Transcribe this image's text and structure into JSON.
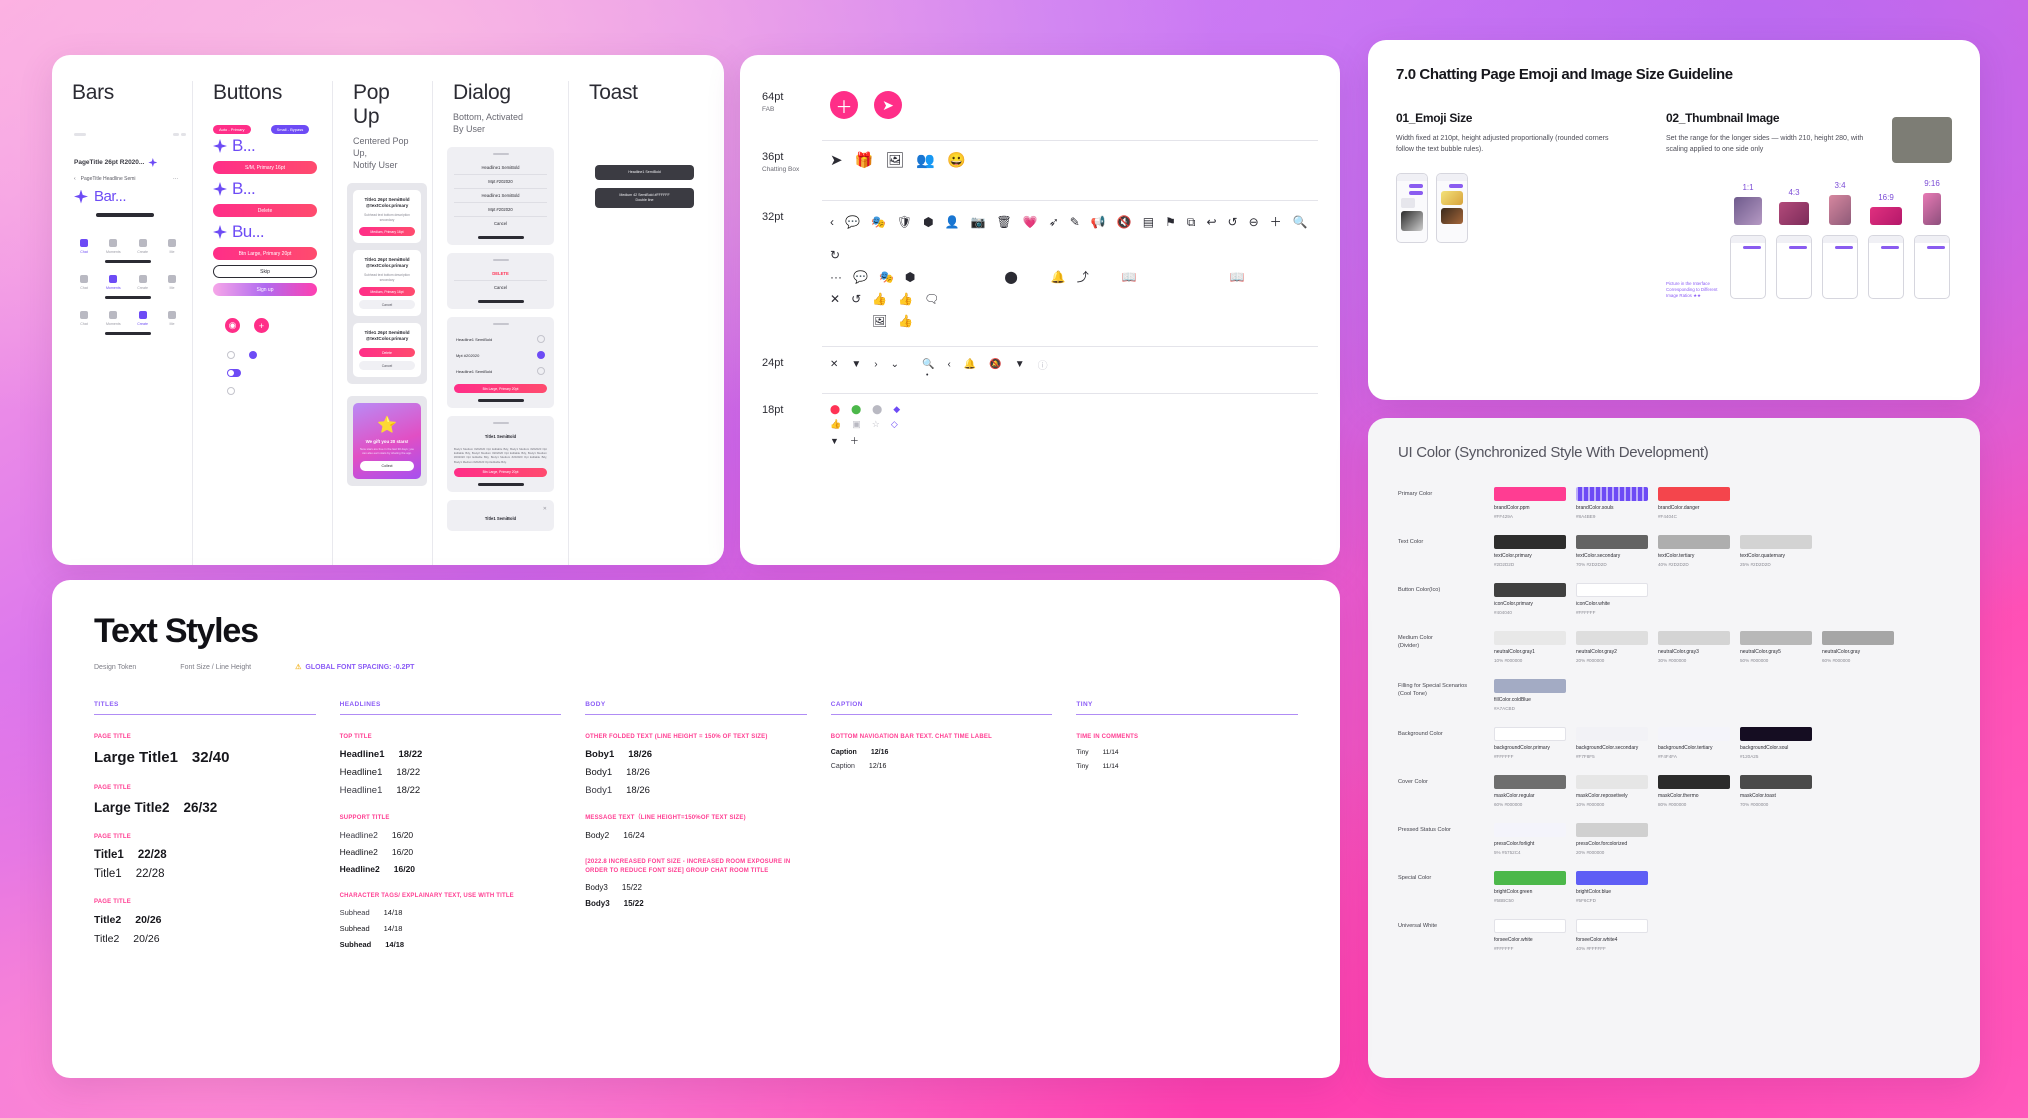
{
  "components": {
    "columns": [
      {
        "title": "Bars",
        "subtitle": ""
      },
      {
        "title": "Buttons",
        "subtitle": ""
      },
      {
        "title": "Pop Up",
        "subtitle": "Centered Pop Up,\nNotify User"
      },
      {
        "title": "Dialog",
        "subtitle": "Bottom, Activated\nBy User"
      },
      {
        "title": "Toast",
        "subtitle": ""
      }
    ],
    "bars": {
      "page_title": "PageTitle 26pt R2020...",
      "nav_label": "PageTitle Headline Semi",
      "big_bar_label": "Bar...",
      "tab_items": [
        "Chat",
        "Moments",
        "Create",
        "Me"
      ]
    },
    "buttons": {
      "tag_primary": "Auto - Primary",
      "tag_layers": "Small - Bypass",
      "label_b1": "B...",
      "label_b2": "B...",
      "label_b3": "Bu...",
      "pill_small": "S/M, Primary 16pt",
      "pill_delete": "Delete",
      "pill_large": "Btn Large, Primary 20pt",
      "pill_skip": "Skip",
      "pill_signup": "Sign up"
    },
    "popup": {
      "cards": [
        {
          "title": "Title1 26pt SemiBold\n@textColor.primary",
          "body": "Subhead text bottom description secondary",
          "primary": "Medium, Primary 16pt",
          "secondary": ""
        },
        {
          "title": "Title1 26pt SemiBold\n@textColor.primary",
          "body": "Subhead text bottom description secondary",
          "primary": "Medium, Primary 16pt",
          "secondary": "Cancel"
        },
        {
          "title": "Title1 26pt SemiBold\n@textColor.primary",
          "body": "",
          "primary": "Delete",
          "secondary": "Cancel"
        }
      ],
      "gift": {
        "title": "We gift you 20 stars!",
        "body": "New stars are free in the last 30 days; you can also earn stars by sharing the app.",
        "button": "Collect"
      }
    },
    "dialog": {
      "sheet1": [
        "Headline1 SemiBold",
        "Mpt #202020",
        "Headline1 SemiBold",
        "Mpt #202020",
        "Cancel"
      ],
      "sheet2": [
        "DELETE",
        "Cancel"
      ],
      "sheet3_options": [
        "Headline1 SemiBold",
        "Mpt #202020",
        "Headline1 SemiBold"
      ],
      "sheet3_button": "Btn Large, Primary 20pt",
      "sheet4_title": "Title1 SemiBold",
      "sheet4_body": "Body1 Medium #202020 Opt Editable Bdy, Body1 Medium #202020 Opt Editable Bdy, Body2 Medium #202020 Opt Editable Bdy, Body1 Medium #202020 Opt Editable Bdy, Body1 Medium #202020 Opt Editable Bdy, Body1 Medium #202020 Opt Editable Bdy.",
      "sheet4_button": "Btn Large, Primary 20pt",
      "sheet5_title": "Title1 SemiBold"
    },
    "toast": {
      "items": [
        "Headline1 SemiBold",
        "Medium 42 SemiBold #FFFFFF\nDouble line"
      ]
    }
  },
  "icons": {
    "sizes": [
      {
        "pt": "64pt",
        "note": "FAB"
      },
      {
        "pt": "36pt",
        "note": "Chatting Box"
      },
      {
        "pt": "32pt",
        "note": ""
      },
      {
        "pt": "24pt",
        "note": ""
      },
      {
        "pt": "18pt",
        "note": ""
      }
    ]
  },
  "emoji_guideline": {
    "title": "7.0 Chatting Page Emoji and Image Size Guideline",
    "section1": {
      "heading": "01_Emoji Size",
      "body": "Width fixed at 210pt, height adjusted proportionally (rounded corners follow the text bubble rules)."
    },
    "section2": {
      "heading": "02_Thumbnail Image",
      "body": "Set the range for the longer sides — width 210, height 280, with scaling applied to one side only",
      "ratios": [
        "1:1",
        "4:3",
        "3:4",
        "16:9",
        "9:16"
      ],
      "side_note": "Picture in the Interface Corresponding to Different Image Ratios ★★"
    }
  },
  "ui_color": {
    "title": "UI Color (Synchronized Style With Development)",
    "rows": [
      {
        "label": "Primary Color",
        "swatches": [
          {
            "name": "brandColor.ppm",
            "hex": "#FF429A",
            "color": "#ff3d92",
            "dotted": false
          },
          {
            "name": "brandColor.souls",
            "hex": "#8A4BE9",
            "color": "#6d4bf5",
            "dotted": true
          },
          {
            "name": "brandColor.danger",
            "hex": "#F4404C",
            "color": "#f4454c",
            "dotted": false
          }
        ]
      },
      {
        "label": "Text Color",
        "swatches": [
          {
            "name": "textColor.primary",
            "hex": "#2D2D2D",
            "color": "#2d2d2d",
            "dotted": false
          },
          {
            "name": "textColor.secondary",
            "hex": "70% #2D2D2D",
            "color": "#636363",
            "dotted": false
          },
          {
            "name": "textColor.tertiary",
            "hex": "40% #2D2D2D",
            "color": "#aeaeae",
            "dotted": false
          },
          {
            "name": "textColor.quaternary",
            "hex": "25% #2D2D2D",
            "color": "#d3d3d3",
            "dotted": false
          }
        ]
      },
      {
        "label": "Button Color(Ico)",
        "swatches": [
          {
            "name": "iconColor.primary",
            "hex": "#404040",
            "color": "#404040",
            "dotted": false
          },
          {
            "name": "iconColor.white",
            "hex": "#FFFFFF",
            "color": "#ffffff",
            "dotted": false
          }
        ]
      },
      {
        "label": "Medium Color\n(Divider)",
        "swatches": [
          {
            "name": "neutralColor.gray1",
            "hex": "10% #000000",
            "color": "#e8e8e8",
            "dotted": false
          },
          {
            "name": "neutralColor.gray2",
            "hex": "20% #000000",
            "color": "#dedede",
            "dotted": false
          },
          {
            "name": "neutralColor.gray3",
            "hex": "30% #000000",
            "color": "#d4d4d4",
            "dotted": false
          },
          {
            "name": "neutralColor.gray5",
            "hex": "50% #000000",
            "color": "#b8b8b8",
            "dotted": false
          },
          {
            "name": "neutralColor.gray",
            "hex": "60% #000000",
            "color": "#a6a6a6",
            "dotted": false
          }
        ]
      },
      {
        "label": "Filling for Special Scenarios\n(Cool Tone)",
        "swatches": [
          {
            "name": "fillColor.coldBlue",
            "hex": "#A7ACBD",
            "color": "#a3abc4",
            "dotted": false
          }
        ]
      },
      {
        "label": "Background Color",
        "swatches": [
          {
            "name": "backgroundColor.primary",
            "hex": "#FFFFFF",
            "color": "#ffffff",
            "dotted": false
          },
          {
            "name": "backgroundColor.secondary",
            "hex": "#F7F8F5",
            "color": "#f2f2f6",
            "dotted": false
          },
          {
            "name": "backgroundColor.tertiary",
            "hex": "#F4F4FA",
            "color": "#f4f4fa",
            "dotted": false
          },
          {
            "name": "backgroundColor.soul",
            "hex": "#120A25",
            "color": "#150d22",
            "dotted": false
          }
        ]
      },
      {
        "label": "Cover Color",
        "swatches": [
          {
            "name": "maskColor.regular",
            "hex": "60% #000000",
            "color": "#6e6e6e",
            "dotted": false
          },
          {
            "name": "maskColor.reposetively",
            "hex": "10% #000000",
            "color": "#e6e6e6",
            "dotted": false
          },
          {
            "name": "maskColor.thermo",
            "hex": "80% #000000",
            "color": "#2b2b2b",
            "dotted": false
          },
          {
            "name": "maskColor.toast",
            "hex": "70% #000000",
            "color": "#4a4a4a",
            "dotted": false
          }
        ]
      },
      {
        "label": "Pressed Status Color",
        "swatches": [
          {
            "name": "pressColor.forlight",
            "hex": "5% #5752C4",
            "color": "#f4f4fb",
            "dotted": false
          },
          {
            "name": "pressColor.forcolorized",
            "hex": "20% #000000",
            "color": "#d0d0d0",
            "dotted": false
          }
        ]
      },
      {
        "label": "Special Color",
        "swatches": [
          {
            "name": "brightColor.green",
            "hex": "#5BBC50",
            "color": "#4cb84a",
            "dotted": false
          },
          {
            "name": "brightColor.blue",
            "hex": "#5F6CFD",
            "color": "#5f5ef5",
            "dotted": false
          }
        ]
      },
      {
        "label": "Universal White",
        "swatches": [
          {
            "name": "forseeColor.white",
            "hex": "#FFFFFF",
            "color": "#ffffff",
            "dotted": false
          },
          {
            "name": "forseeColor.white4",
            "hex": "40% #FFFFFF",
            "color": "#ffffff",
            "dotted": false
          }
        ]
      }
    ]
  },
  "text_styles": {
    "title": "Text Styles",
    "meta_token": "Design Token",
    "meta_size": "Font Size / Line Height",
    "meta_warning": "GLOBAL FONT SPACING: -0.2PT",
    "columns": [
      {
        "head": "TITLES",
        "groups": [
          {
            "tag": "PAGE TITLE",
            "rows": [
              {
                "name": "Large Title1",
                "size": "32/40",
                "weight": "700",
                "cls": "s32"
              }
            ]
          },
          {
            "tag": "PAGE TITLE",
            "rows": [
              {
                "name": "Large Title2",
                "size": "26/32",
                "weight": "700",
                "cls": "s26"
              }
            ]
          },
          {
            "tag": "PAGE TITLE",
            "rows": [
              {
                "name": "Title1",
                "size": "22/28",
                "weight": "700",
                "cls": "s22"
              },
              {
                "name": "Title1",
                "size": "22/28",
                "weight": "400",
                "cls": "s22"
              }
            ]
          },
          {
            "tag": "PAGE TITLE",
            "rows": [
              {
                "name": "Title2",
                "size": "20/26",
                "weight": "700",
                "cls": "s20"
              },
              {
                "name": "Title2",
                "size": "20/26",
                "weight": "400",
                "cls": "s20"
              }
            ]
          }
        ]
      },
      {
        "head": "HEADLINES",
        "groups": [
          {
            "tag": "TOP TITLE",
            "rows": [
              {
                "name": "Headline1",
                "size": "18/22",
                "weight": "700",
                "cls": "s18"
              },
              {
                "name": "Headline1",
                "size": "18/22",
                "weight": "400",
                "cls": "s18"
              },
              {
                "name": "Headline1",
                "size": "18/22",
                "weight": "300",
                "cls": "s18"
              }
            ]
          },
          {
            "tag": "SUPPORT TITLE",
            "rows": [
              {
                "name": "Headline2",
                "size": "16/20",
                "weight": "300",
                "cls": "s16"
              },
              {
                "name": "Headline2",
                "size": "16/20",
                "weight": "400",
                "cls": "s16"
              },
              {
                "name": "Headline2",
                "size": "16/20",
                "weight": "700",
                "cls": "s16"
              }
            ]
          },
          {
            "tag": "CHARACTER TAGS/ EXPLAINARY TEXT, USE WITH TITLE",
            "rows": [
              {
                "name": "Subhead",
                "size": "14/18",
                "weight": "300",
                "cls": "s14"
              },
              {
                "name": "Subhead",
                "size": "14/18",
                "weight": "400",
                "cls": "s14"
              },
              {
                "name": "Subhead",
                "size": "14/18",
                "weight": "700",
                "cls": "s14"
              }
            ]
          }
        ]
      },
      {
        "head": "BODY",
        "groups": [
          {
            "tag": "OTHER FOLDED TEXT (LINE HEIGHT = 150% OF TEXT SIZE)",
            "rows": [
              {
                "name": "Boby1",
                "size": "18/26",
                "weight": "700",
                "cls": "s18"
              },
              {
                "name": "Body1",
                "size": "18/26",
                "weight": "400",
                "cls": "s18"
              },
              {
                "name": "Body1",
                "size": "18/26",
                "weight": "300",
                "cls": "s18"
              }
            ]
          },
          {
            "tag": "MESSAGE TEXT（LINE HEIGHT=150%OF TEXT SIZE)",
            "rows": [
              {
                "name": "Body2",
                "size": "16/24",
                "weight": "400",
                "cls": "s16"
              }
            ]
          },
          {
            "tag": "[2022.8 INCREASED FONT SIZE - INCREASED ROOM EXPOSURE IN ORDER TO REDUCE FONT SIZE] GROUP CHAT ROOM TITLE",
            "rows": [
              {
                "name": "Body3",
                "size": "15/22",
                "weight": "400",
                "cls": "s15"
              },
              {
                "name": "Body3",
                "size": "15/22",
                "weight": "700",
                "cls": "s15"
              }
            ]
          }
        ]
      },
      {
        "head": "CAPTION",
        "groups": [
          {
            "tag": "BOTTOM NAVIGATION BAR TEXT. CHAT TIME LABEL",
            "rows": [
              {
                "name": "Caption",
                "size": "12/16",
                "weight": "700",
                "cls": "s12"
              },
              {
                "name": "Caption",
                "size": "12/16",
                "weight": "300",
                "cls": "s12"
              }
            ]
          }
        ]
      },
      {
        "head": "TINY",
        "groups": [
          {
            "tag": "TIME IN COMMENTS",
            "rows": [
              {
                "name": "Tiny",
                "size": "11/14",
                "weight": "400",
                "cls": "s11"
              },
              {
                "name": "Tiny",
                "size": "11/14",
                "weight": "400",
                "cls": "s11"
              }
            ]
          }
        ]
      }
    ]
  }
}
